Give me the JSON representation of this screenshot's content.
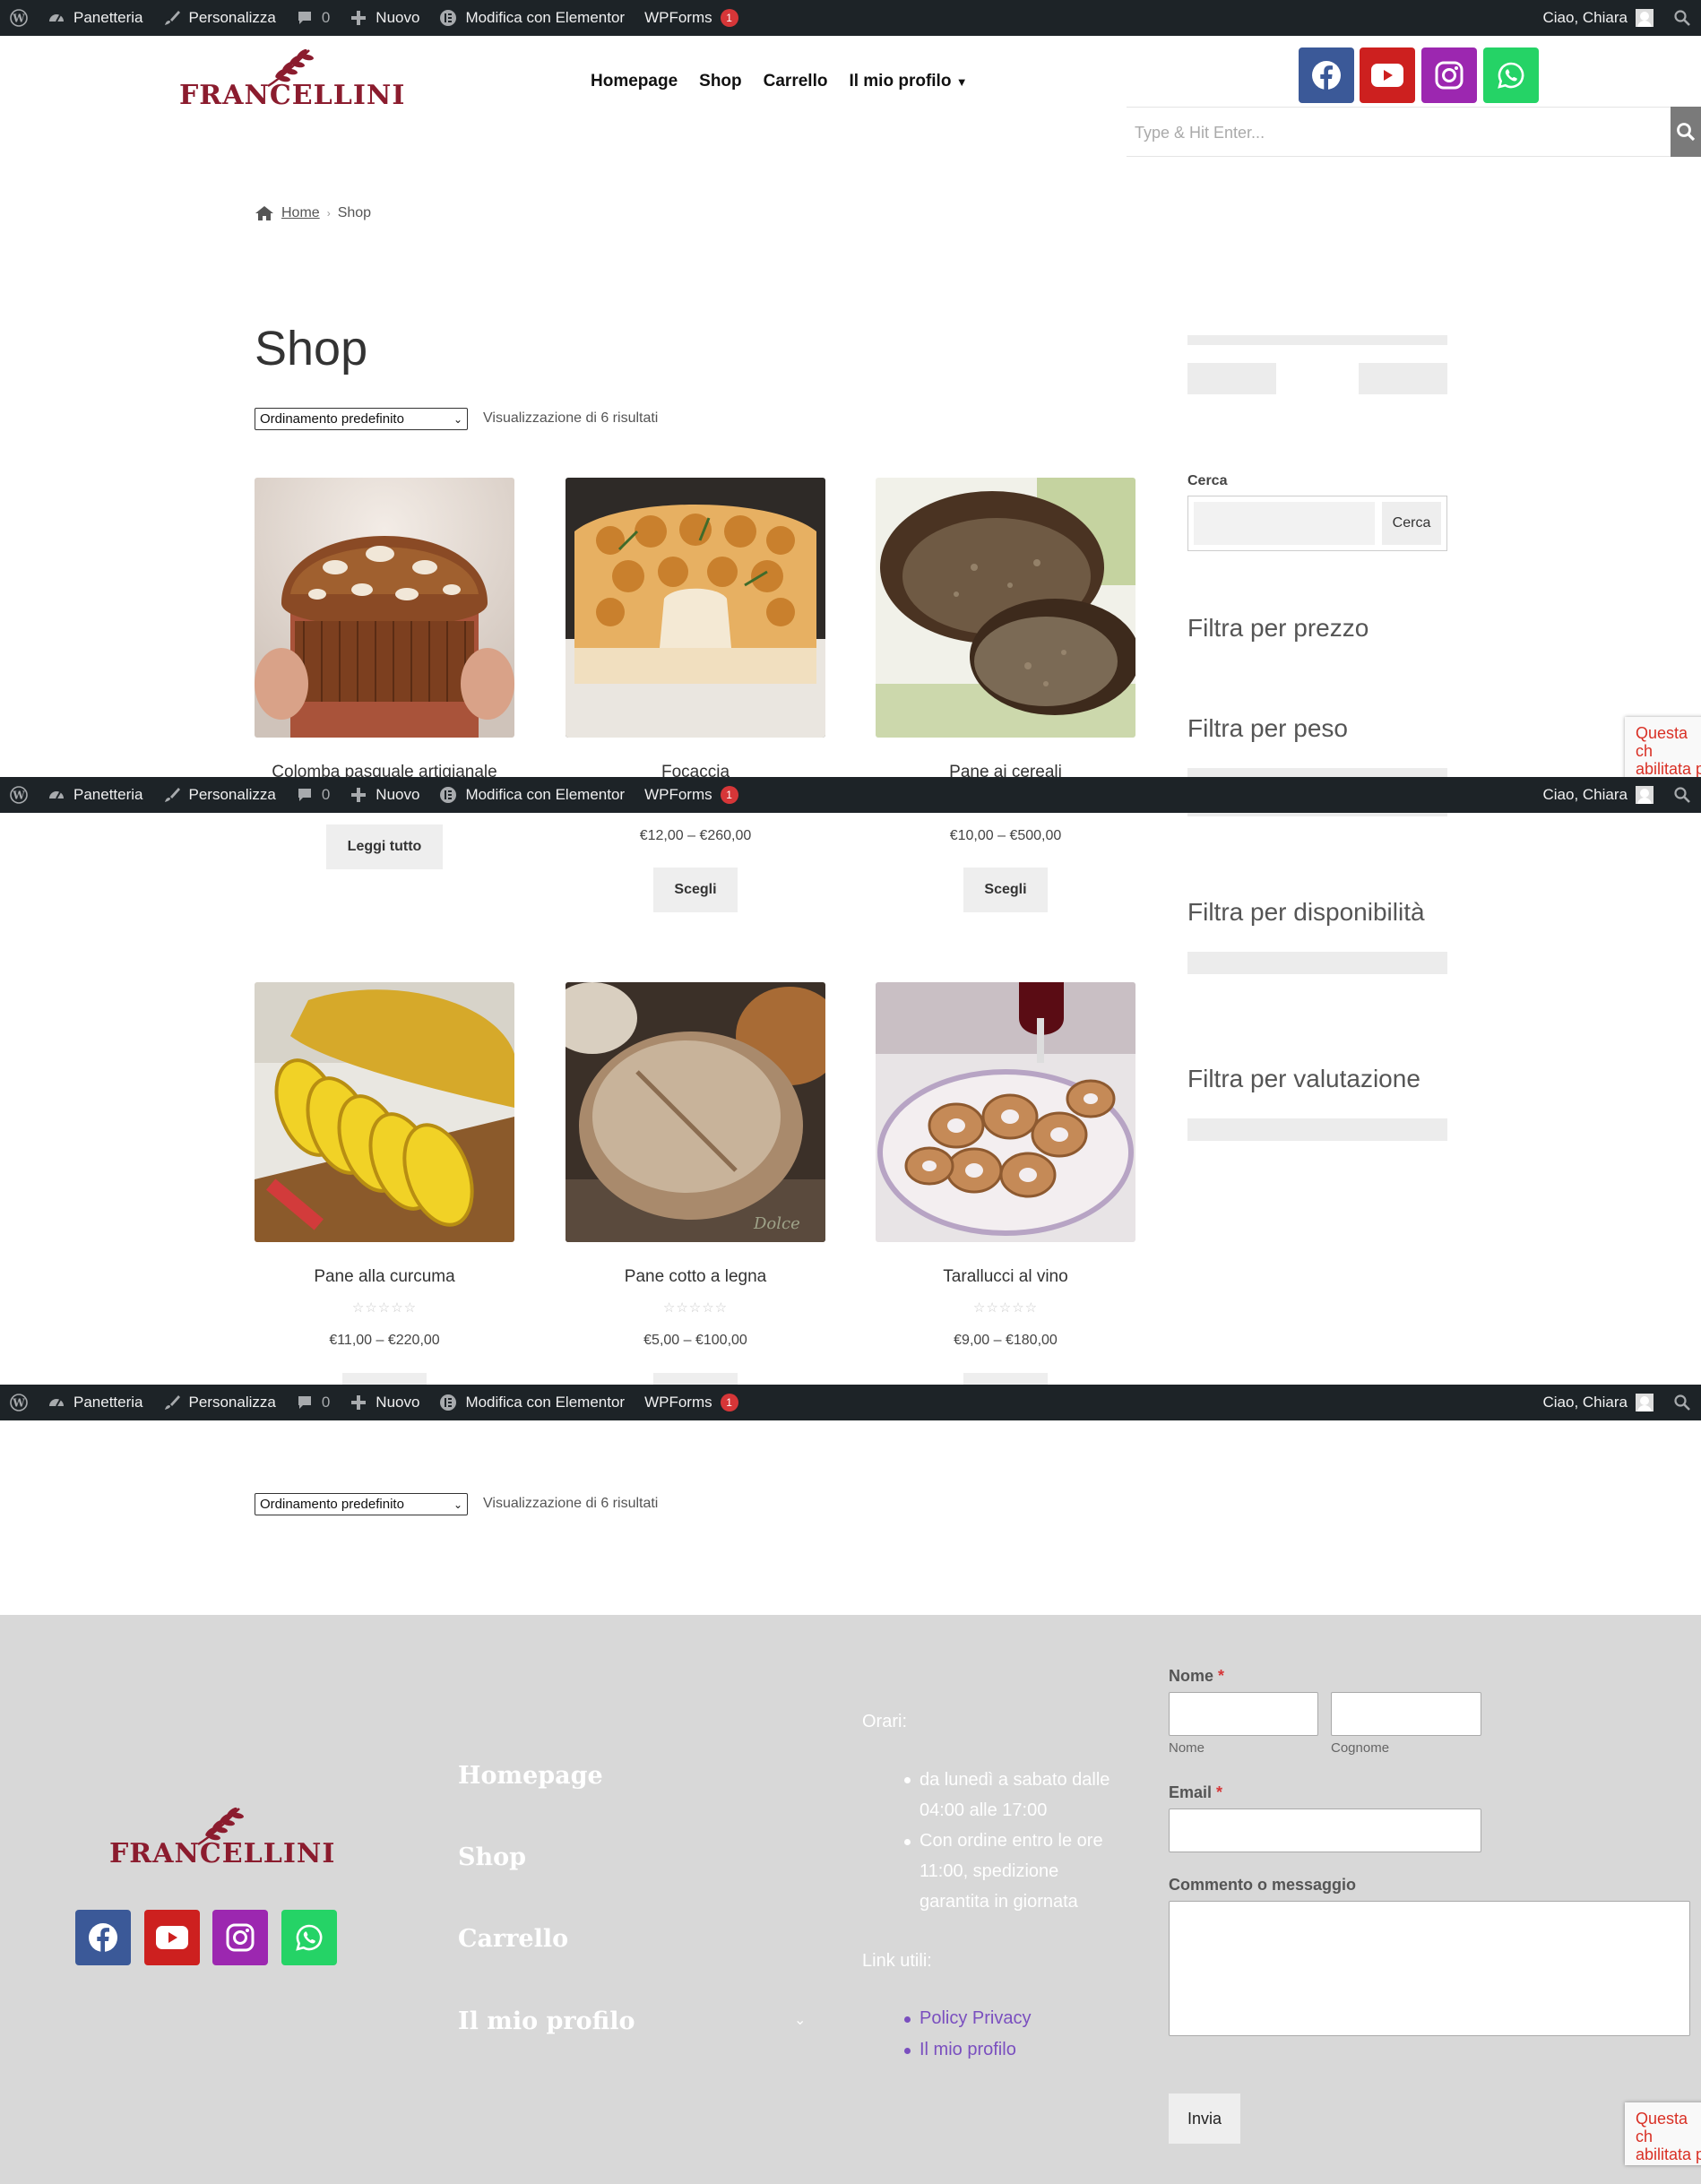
{
  "admin_bar": {
    "site_name": "Panetteria",
    "customize": "Personalizza",
    "comments_count": "0",
    "new": "Nuovo",
    "elementor": "Modifica con Elementor",
    "wpforms": "WPForms",
    "wpforms_badge": "1",
    "greeting": "Ciao, Chiara"
  },
  "header": {
    "logo_text": "FRANCELLINI",
    "nav": [
      "Homepage",
      "Shop",
      "Carrello",
      "Il mio profilo"
    ],
    "search_placeholder": "Type & Hit Enter..."
  },
  "breadcrumb": {
    "home": "Home",
    "current": "Shop"
  },
  "shop": {
    "title": "Shop",
    "orderby": "Ordinamento predefinito",
    "result_count": "Visualizzazione di 6 risultati"
  },
  "products": [
    {
      "name": "Colomba pasquale artigianale",
      "button": "Leggi tutto"
    },
    {
      "name": "Focaccia",
      "price": "€12,00 – €260,00",
      "button": "Scegli"
    },
    {
      "name": "Pane ai cereali",
      "price": "€10,00 – €500,00",
      "button": "Scegli"
    },
    {
      "name": "Pane alla curcuma",
      "stars": "☆☆☆☆☆",
      "price": "€11,00 – €220,00"
    },
    {
      "name": "Pane cotto a legna",
      "stars": "☆☆☆☆☆",
      "price": "€5,00 – €100,00"
    },
    {
      "name": "Tarallucci al vino",
      "stars": "☆☆☆☆☆",
      "price": "€9,00 – €180,00"
    }
  ],
  "sidebar": {
    "search_label": "Cerca",
    "search_button": "Cerca",
    "filters": [
      "Filtra per prezzo",
      "Filtra per peso",
      "Filtra per disponibilità",
      "Filtra per valutazione"
    ]
  },
  "recaptcha_text": "Questa ch\nabilitata p\ninvisibile.",
  "footer": {
    "logo_text": "FRANCELLINI",
    "nav": [
      "Homepage",
      "Shop",
      "Carrello",
      "Il mio profilo"
    ],
    "hours_title": "Orari:",
    "hours": [
      "da lunedì a sabato dalle",
      "04:00 alle 17:00",
      "Con ordine entro le ore",
      "11:00, spedizione",
      "garantita in giornata"
    ],
    "links_title": "Link utili:",
    "links": [
      "Policy Privacy",
      "Il mio profilo"
    ],
    "form": {
      "name_label": "Nome",
      "required_mark": "*",
      "first_sub": "Nome",
      "last_sub": "Cognome",
      "email_label": "Email",
      "message_label": "Commento o messaggio",
      "submit": "Invia"
    }
  },
  "colors": {
    "brand": "#8b1c2e",
    "admin_bar": "#1d2327",
    "facebook": "#3b5998",
    "youtube": "#cd201f",
    "instagram": "#9c27b0",
    "whatsapp": "#25d366"
  }
}
